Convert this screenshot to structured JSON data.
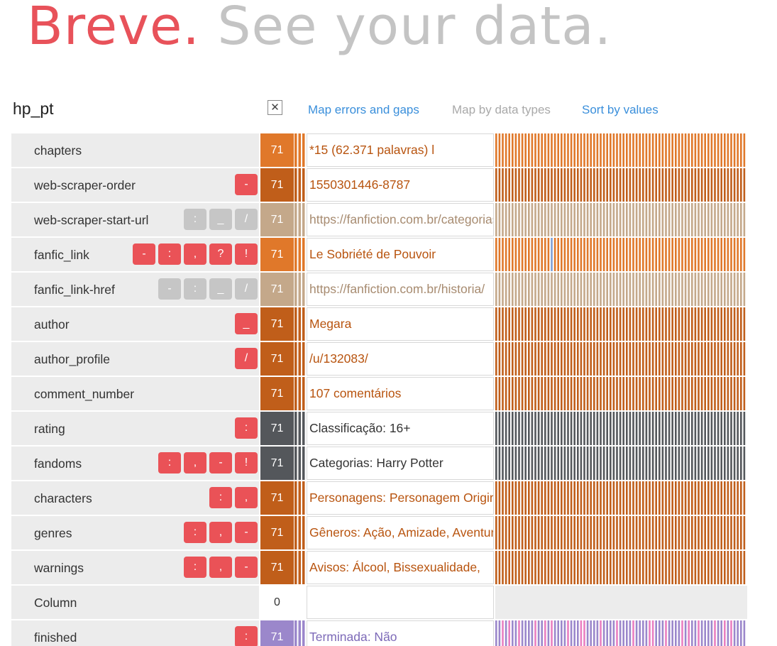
{
  "hero": {
    "brand": "Breve.",
    "tagline": "See your data."
  },
  "dataset": {
    "name": "hp_pt",
    "close_symbol": "✕"
  },
  "modes": [
    {
      "label": "Map errors and gaps",
      "active": true
    },
    {
      "label": "Map by data types",
      "active": false
    },
    {
      "label": "Sort by values",
      "active": true
    }
  ],
  "palette": {
    "orange": "#e0782a",
    "rust": "#c05e1a",
    "tan": "#c4a88a",
    "slate": "#54575b",
    "purple": "#9b87cb",
    "pink": "#e97fc1",
    "blue": "#7e9fd6",
    "red_badge": "#ea5257",
    "grey_badge": "#c6c6c6",
    "empty": "#ececec"
  },
  "columns": [
    {
      "name": "chapters",
      "badges": [],
      "badge_style": "red",
      "count": "71",
      "color": "orange",
      "text_color": "#b8540f",
      "sample": "*15 (62.371 palavras) l",
      "viz": "solid"
    },
    {
      "name": "web-scraper-order",
      "badges": [
        "-"
      ],
      "badge_style": "red",
      "count": "71",
      "color": "rust",
      "text_color": "#b8540f",
      "sample": "1550301446-8787",
      "viz": "solid"
    },
    {
      "name": "web-scraper-start-url",
      "badges": [
        ":",
        "_",
        "/"
      ],
      "badge_style": "grey",
      "count": "71",
      "color": "tan",
      "text_color": "#a78b70",
      "sample": "https://fanfiction.com.br/categorias/",
      "viz": "solid"
    },
    {
      "name": "fanfic_link",
      "badges": [
        "-",
        ":",
        ",",
        "?",
        "!"
      ],
      "badge_style": "red",
      "count": "71",
      "color": "orange",
      "text_color": "#b8540f",
      "sample": "Le Sobriété de Pouvoir",
      "viz": "oddbar"
    },
    {
      "name": "fanfic_link-href",
      "badges": [
        "-",
        ":",
        "_",
        "/"
      ],
      "badge_style": "grey",
      "count": "71",
      "color": "tan",
      "text_color": "#a78b70",
      "sample": "https://fanfiction.com.br/historia/",
      "viz": "solid"
    },
    {
      "name": "author",
      "badges": [
        "_"
      ],
      "badge_style": "red",
      "count": "71",
      "color": "rust",
      "text_color": "#b8540f",
      "sample": "Megara",
      "viz": "solid"
    },
    {
      "name": "author_profile",
      "badges": [
        "/"
      ],
      "badge_style": "red",
      "count": "71",
      "color": "rust",
      "text_color": "#b8540f",
      "sample": "/u/132083/",
      "viz": "solid"
    },
    {
      "name": "comment_number",
      "badges": [],
      "badge_style": "red",
      "count": "71",
      "color": "rust",
      "text_color": "#b8540f",
      "sample": "107 comentários",
      "viz": "solid"
    },
    {
      "name": "rating",
      "badges": [
        ":"
      ],
      "badge_style": "red",
      "count": "71",
      "color": "slate",
      "text_color": "#333333",
      "sample": "Classificação: 16+",
      "viz": "solid"
    },
    {
      "name": "fandoms",
      "badges": [
        ":",
        ",",
        "-",
        "!"
      ],
      "badge_style": "red",
      "count": "71",
      "color": "slate",
      "text_color": "#333333",
      "sample": "Categorias: Harry Potter",
      "viz": "solid"
    },
    {
      "name": "characters",
      "badges": [
        ":",
        ","
      ],
      "badge_style": "red",
      "count": "71",
      "color": "rust",
      "text_color": "#b8540f",
      "sample": "Personagens: Personagem Original",
      "viz": "solid"
    },
    {
      "name": "genres",
      "badges": [
        ":",
        ",",
        "-"
      ],
      "badge_style": "red",
      "count": "71",
      "color": "rust",
      "text_color": "#b8540f",
      "sample": "Gêneros:  Ação, Amizade, Aventura",
      "viz": "solid"
    },
    {
      "name": "warnings",
      "badges": [
        ":",
        ",",
        "-"
      ],
      "badge_style": "red",
      "count": "71",
      "color": "rust",
      "text_color": "#b8540f",
      "sample": "Avisos:  Álcool, Bissexualidade,",
      "viz": "solid"
    },
    {
      "name": "Column",
      "badges": [],
      "badge_style": "red",
      "count": "0",
      "color": "empty",
      "text_color": "#333333",
      "sample": "",
      "viz": "empty"
    },
    {
      "name": "finished",
      "badges": [
        ":"
      ],
      "badge_style": "red",
      "count": "71",
      "color": "purple",
      "text_color": "#7d6ab8",
      "sample": "Terminada: Não",
      "viz": "mixed"
    }
  ]
}
